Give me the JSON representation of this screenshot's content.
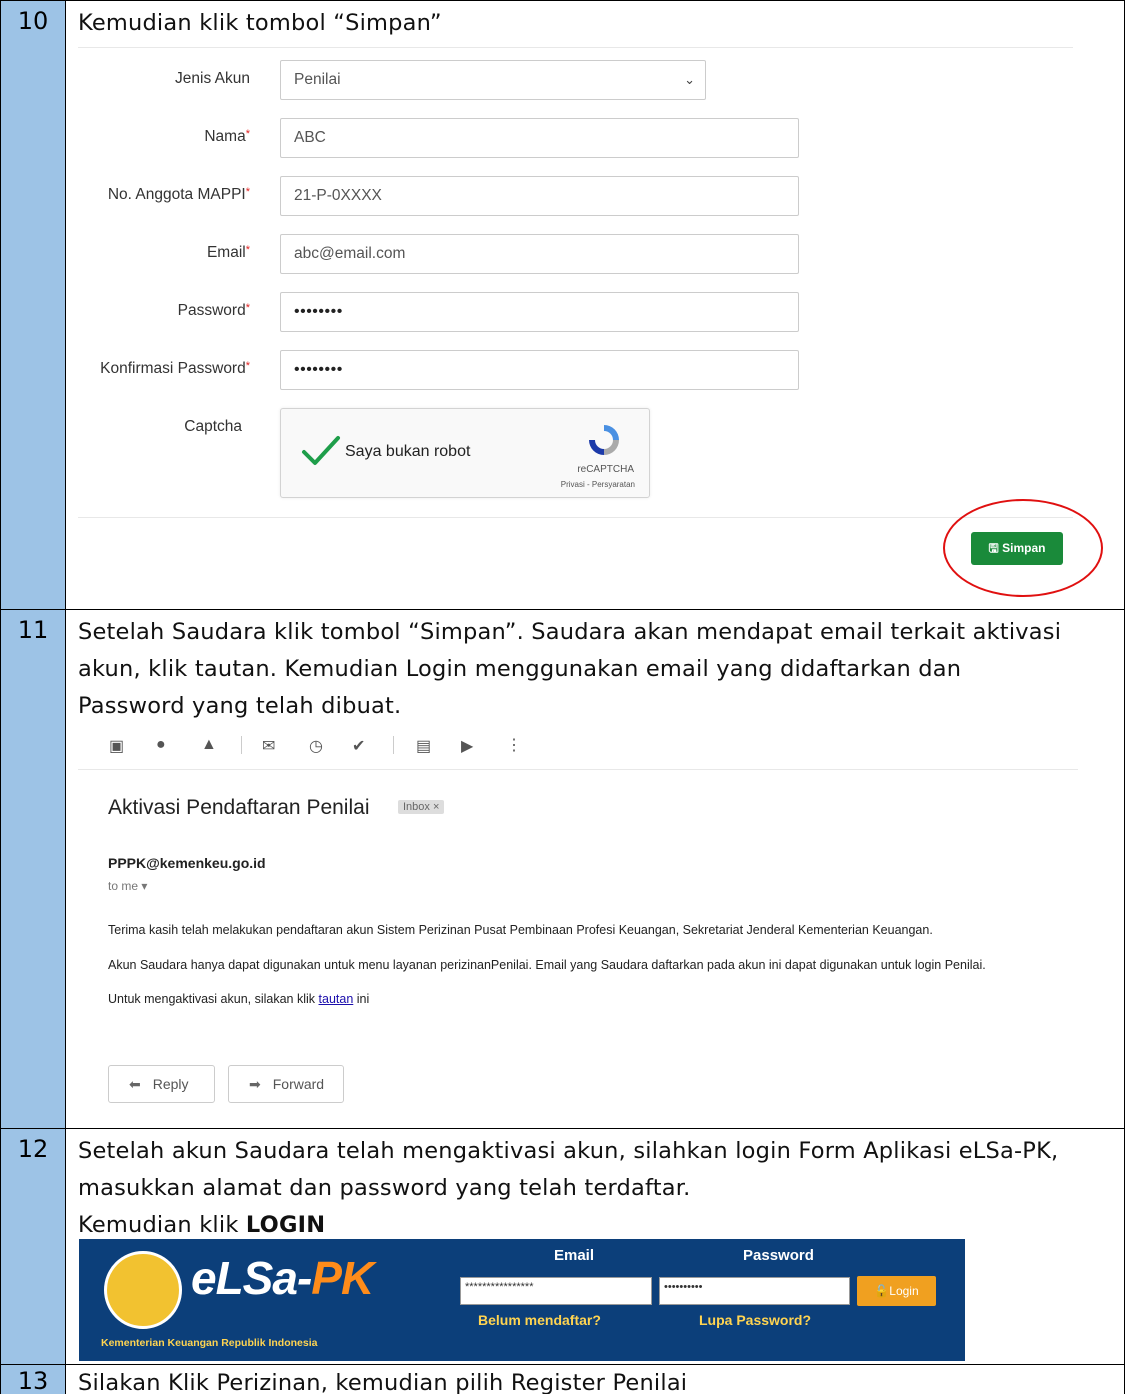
{
  "steps": [
    {
      "number": "10",
      "text": "Kemudian klik tombol “Simpan”"
    },
    {
      "number": "11",
      "lines": [
        "Setelah Saudara klik tombol “Simpan”. Saudara akan mendapat email terkait aktivasi",
        "akun, klik tautan. Kemudian Login menggunakan email yang didaftarkan dan",
        "Password yang telah dibuat."
      ]
    },
    {
      "number": "12",
      "lines": [
        "Setelah akun Saudara telah mengaktivasi akun, silahkan login Form Aplikasi eLSa-PK,",
        "masukkan alamat dan password yang telah terdaftar."
      ],
      "line3_prefix": "Kemudian klik ",
      "line3_bold": "LOGIN"
    },
    {
      "number": "13",
      "text": "Silakan Klik Perizinan, kemudian pilih Register Penilai"
    }
  ],
  "form": {
    "jenis_akun_label": "Jenis Akun",
    "jenis_akun_value": "Penilai",
    "nama_label": "Nama",
    "nama_value": "ABC",
    "mappi_label": "No. Anggota MAPPI",
    "mappi_value": "21-P-0XXXX",
    "email_label": "Email",
    "email_value": "abc@email.com",
    "password_label": "Password",
    "password_value": "••••••••",
    "konfirmasi_label": "Konfirmasi Password",
    "konfirmasi_value": "••••••••",
    "required_mark": "*",
    "captcha_label": "Captcha",
    "captcha_text": "Saya bukan robot",
    "recaptcha_brand": "reCAPTCHA",
    "recaptcha_links": "Privasi - Persyaratan",
    "simpan_label": "Simpan"
  },
  "email": {
    "subject": "Aktivasi Pendaftaran Penilai",
    "inbox_tag": "Inbox ×",
    "sender": "PPPK@kemenkeu.go.id",
    "to_me": "to me ▾",
    "body_1": "Terima kasih telah melakukan pendaftaran akun Sistem Perizinan Pusat Pembinaan Profesi Keuangan, Sekretariat Jenderal Kementerian Keuangan.",
    "body_2": "Akun Saudara hanya dapat digunakan untuk menu layanan perizinanPenilai. Email yang Saudara daftarkan pada akun ini dapat digunakan untuk login Penilai.",
    "body_3_prefix": "Untuk mengaktivasi akun, silakan klik ",
    "body_3_link": "tautan",
    "body_3_suffix": " ini",
    "reply_label": "Reply",
    "forward_label": "Forward",
    "toolbar_icons": [
      "archive-icon",
      "report-spam-icon",
      "delete-icon",
      "mark-unread-icon",
      "snooze-icon",
      "add-task-icon",
      "move-to-icon",
      "labels-icon",
      "more-icon"
    ]
  },
  "banner": {
    "brand_prefix": "eLSa-",
    "brand_suffix": "PK",
    "ministry": "Kementerian Keuangan Republik Indonesia",
    "email_header": "Email",
    "password_header": "Password",
    "email_value": "****************",
    "password_value": "••••••••••",
    "login_label": "Login",
    "belum_mendaftar": "Belum mendaftar?",
    "lupa_password": "Lupa Password?"
  }
}
